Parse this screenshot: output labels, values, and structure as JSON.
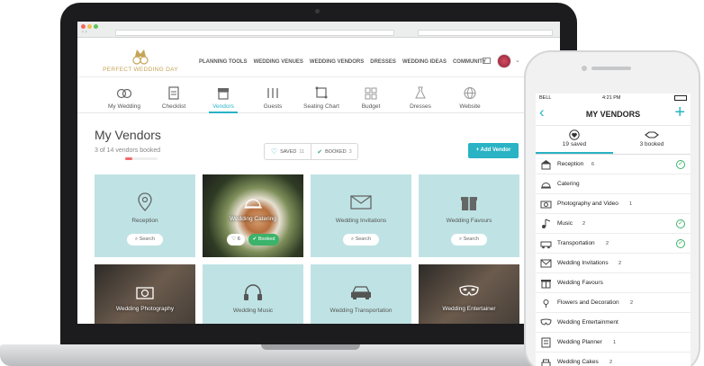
{
  "colors": {
    "accent": "#29b3c4",
    "card": "#bfe3e4",
    "booked": "#3bb36a",
    "progress": "#f06b6b",
    "logo": "#c5a459"
  },
  "laptop": {
    "logo_text": "PERFECT WEDDING DAY",
    "top_nav": [
      "PLANNING TOOLS",
      "WEDDING VENUES",
      "WEDDING VENDORS",
      "DRESSES",
      "WEDDING IDEAS",
      "COMMUNITY"
    ],
    "tabs": [
      {
        "label": "My Wedding",
        "icon": "rings-icon"
      },
      {
        "label": "Checklist",
        "icon": "clipboard-icon"
      },
      {
        "label": "Vendors",
        "icon": "shop-icon"
      },
      {
        "label": "Guests",
        "icon": "guests-icon"
      },
      {
        "label": "Seating Chart",
        "icon": "seating-icon"
      },
      {
        "label": "Budget",
        "icon": "budget-icon"
      },
      {
        "label": "Dresses",
        "icon": "dress-icon"
      },
      {
        "label": "Website",
        "icon": "globe-icon"
      }
    ],
    "active_tab": "Vendors",
    "page_title": "My Vendors",
    "booked_text": "3 of 14 vendors booked",
    "booked_progress": 0.214,
    "saved_label": "SAVED",
    "saved_count": "11",
    "booked_label": "BOOKED",
    "booked_count": "3",
    "add_vendor_label": "+ Add Vendor",
    "cards": [
      {
        "label": "Reception",
        "icon": "pin-icon",
        "search": "Search"
      },
      {
        "label": "Wedding Catering",
        "icon": "cloche-icon",
        "likes": "6",
        "booked": "Booked"
      },
      {
        "label": "Wedding Invitations",
        "icon": "envelope-icon",
        "search": "Search"
      },
      {
        "label": "Wedding Favours",
        "icon": "gift-icon",
        "search": "Search"
      },
      {
        "label": "Wedding Photography",
        "icon": "camera-icon"
      },
      {
        "label": "Wedding Music",
        "icon": "headphones-icon"
      },
      {
        "label": "Wedding Transportation",
        "icon": "car-icon"
      },
      {
        "label": "Wedding Entertainer",
        "icon": "mask-icon"
      }
    ]
  },
  "phone": {
    "carrier": "BELL",
    "time": "4:21 PM",
    "title": "MY VENDORS",
    "tabs": [
      {
        "label": "19 saved",
        "icon": "heart-icon"
      },
      {
        "label": "3 booked",
        "icon": "handshake-icon"
      }
    ],
    "rows": [
      {
        "label": "Reception",
        "count": "6",
        "checked": true
      },
      {
        "label": "Catering",
        "count": "",
        "checked": false
      },
      {
        "label": "Photography and Video",
        "count": "1",
        "checked": false
      },
      {
        "label": "Music",
        "count": "2",
        "checked": true
      },
      {
        "label": "Transportation",
        "count": "2",
        "checked": true
      },
      {
        "label": "Wedding Invitations",
        "count": "2",
        "checked": false
      },
      {
        "label": "Wedding Favours",
        "count": "",
        "checked": false
      },
      {
        "label": "Flowers and Decoration",
        "count": "2",
        "checked": false
      },
      {
        "label": "Wedding Entertainment",
        "count": "",
        "checked": false
      },
      {
        "label": "Wedding Planner",
        "count": "1",
        "checked": false
      },
      {
        "label": "Wedding Cakes",
        "count": "2",
        "checked": false
      }
    ]
  }
}
